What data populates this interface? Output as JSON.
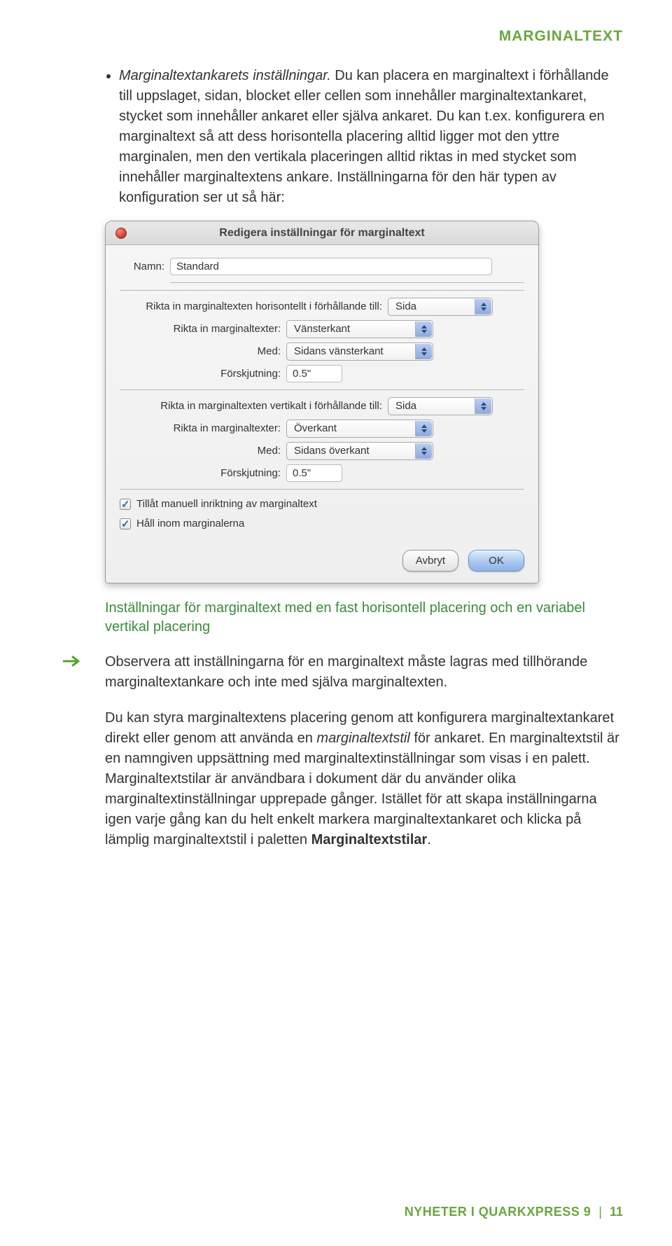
{
  "header": {
    "section": "MARGINALTEXT"
  },
  "intro": {
    "bullet_title": "Marginaltextankarets inställningar.",
    "bullet_text": " Du kan placera en marginaltext i förhållande till uppslaget, sidan, blocket eller cellen som innehåller marginaltextankaret, stycket som innehåller ankaret eller själva ankaret. Du kan t.ex. konfigurera en marginaltext så att dess horisontella placering alltid ligger mot den yttre marginalen, men den vertikala placeringen alltid riktas in med stycket som innehåller marginaltextens ankare. Inställningarna för den här typen av konfiguration ser ut så här:"
  },
  "dialog": {
    "title": "Redigera inställningar för marginaltext",
    "name_label": "Namn:",
    "name_value": "Standard",
    "h_label": "Rikta in marginaltexten horisontellt i förhållande till:",
    "h_value": "Sida",
    "h_align_label": "Rikta in marginaltexter:",
    "h_align_value": "Vänsterkant",
    "h_with_label": "Med:",
    "h_with_value": "Sidans vänsterkant",
    "h_offset_label": "Förskjutning:",
    "h_offset_value": "0.5\"",
    "v_label": "Rikta in marginaltexten vertikalt i förhållande till:",
    "v_value": "Sida",
    "v_align_label": "Rikta in marginaltexter:",
    "v_align_value": "Överkant",
    "v_with_label": "Med:",
    "v_with_value": "Sidans överkant",
    "v_offset_label": "Förskjutning:",
    "v_offset_value": "0.5\"",
    "chk1": "Tillåt manuell inriktning av marginaltext",
    "chk2": "Håll inom marginalerna",
    "cancel": "Avbryt",
    "ok": "OK"
  },
  "caption": "Inställningar för marginaltext med en fast horisontell placering och en variabel vertikal placering",
  "note": "Observera att inställningarna för en marginaltext måste lagras med tillhörande marginaltextankare och inte med själva marginaltexten.",
  "para2_a": "Du kan styra marginaltextens placering genom att konfigurera marginaltextankaret direkt eller genom att använda en ",
  "para2_b": "marginaltextstil",
  "para2_c": " för ankaret. En marginaltextstil är en namngiven uppsättning med marginaltextinställningar som visas i en palett. Marginaltextstilar är användbara i dokument där du använder olika marginaltextinställningar upprepade gånger. Istället för att skapa inställningarna igen varje gång kan du helt enkelt markera marginaltextankaret och klicka på lämplig marginaltextstil i paletten ",
  "para2_d": "Marginaltextstilar",
  "para2_e": ".",
  "footer": {
    "brand": "NYHETER I QUARKXPRESS 9",
    "page": "11"
  }
}
